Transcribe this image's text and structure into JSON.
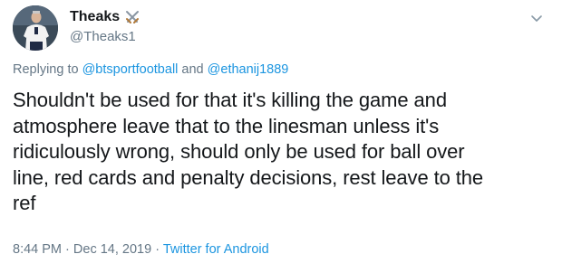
{
  "user": {
    "display_name": "Theaks",
    "handle": "@Theaks1",
    "name_emoji": "crossed-swords-icon"
  },
  "reply": {
    "prefix": "Replying to",
    "mention_1": "@btsportfootball",
    "conjunction": "and",
    "mention_2": "@ethanij1889"
  },
  "tweet": {
    "lines": [
      "Shouldn't be used for that it's killing the game and",
      "atmosphere leave that to the linesman unless it's",
      "ridiculously wrong, should only be used for ball over",
      "line, red cards and penalty decisions, rest leave to the",
      "ref"
    ]
  },
  "meta": {
    "time": "8:44 PM",
    "separator_1": "·",
    "date": "Dec 14, 2019",
    "separator_2": "·",
    "source": "Twitter for Android"
  },
  "colors": {
    "link": "#1b95e0",
    "secondary_text": "#657786",
    "primary_text": "#14171a"
  },
  "icons": {
    "more_menu": "chevron-down-icon",
    "avatar": "avatar"
  }
}
